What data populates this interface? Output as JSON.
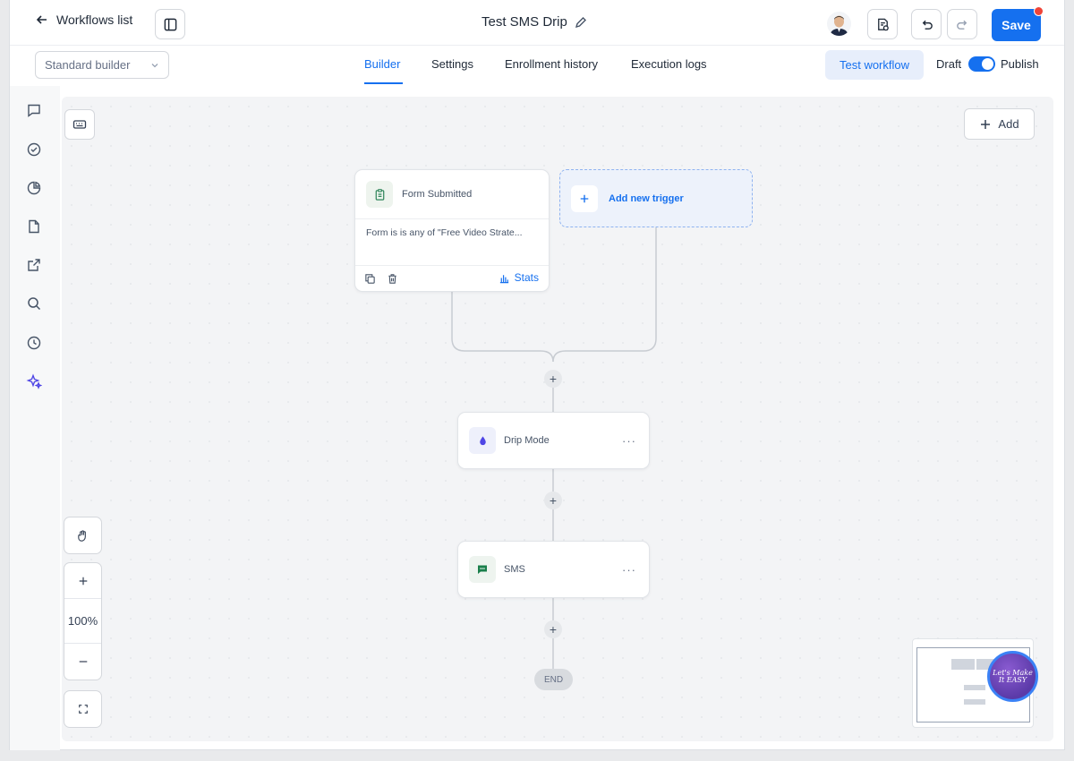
{
  "header": {
    "back_label": "Workflows list",
    "workflow_title": "Test SMS Drip",
    "save_label": "Save"
  },
  "subheader": {
    "builder_mode": "Standard builder",
    "tabs": [
      {
        "label": "Builder",
        "active": true
      },
      {
        "label": "Settings",
        "active": false
      },
      {
        "label": "Enrollment history",
        "active": false
      },
      {
        "label": "Execution logs",
        "active": false
      }
    ],
    "test_label": "Test workflow",
    "draft_label": "Draft",
    "publish_label": "Publish",
    "publish_toggle_on": true
  },
  "canvas": {
    "add_label": "Add",
    "trigger": {
      "title": "Form Submitted",
      "condition": "Form is is any of \"Free Video Strate...",
      "stats_label": "Stats"
    },
    "new_trigger_label": "Add new trigger",
    "actions": [
      {
        "label": "Drip Mode",
        "icon": "drop-icon"
      },
      {
        "label": "SMS",
        "icon": "sms-icon"
      }
    ],
    "end_label": "END",
    "zoom_label": "100%"
  },
  "badge_text": "Let's Make It EASY",
  "colors": {
    "primary": "#1570ef",
    "save_notification": "#f04438",
    "canvas_bg": "#f3f4f6",
    "sms_icon": "#1a7f4b",
    "drip_icon": "#4f46e5"
  }
}
